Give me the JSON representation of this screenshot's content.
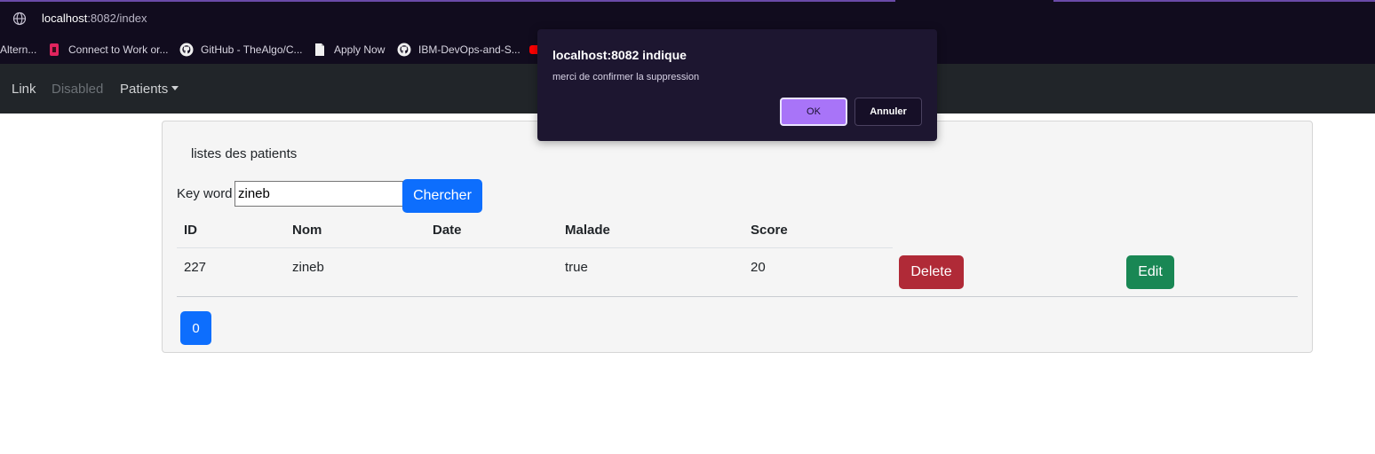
{
  "browser": {
    "url_host": "localhost",
    "url_path": ":8082/index",
    "bookmarks": [
      {
        "label": "Altern...",
        "icon": "page-icon"
      },
      {
        "label": "Connect to Work or...",
        "icon": "app-icon"
      },
      {
        "label": "GitHub - TheAlgo/C...",
        "icon": "github-icon"
      },
      {
        "label": "Apply Now",
        "icon": "document-icon"
      },
      {
        "label": "IBM-DevOps-and-S...",
        "icon": "github-icon"
      }
    ]
  },
  "navbar": {
    "link": "Link",
    "disabled": "Disabled",
    "patients": "Patients"
  },
  "card": {
    "title": "listes des patients",
    "search_label": "Key word",
    "search_value": "zineb",
    "search_button": "Chercher",
    "columns": [
      "ID",
      "Nom",
      "Date",
      "Malade",
      "Score"
    ],
    "rows": [
      {
        "id": "227",
        "nom": "zineb",
        "date": "",
        "malade": "true",
        "score": "20"
      }
    ],
    "delete_button": "Delete",
    "edit_button": "Edit",
    "page_button": "0"
  },
  "dialog": {
    "title": "localhost:8082 indique",
    "message": "merci de confirmer la suppression",
    "ok": "OK",
    "cancel": "Annuler"
  },
  "colors": {
    "primary": "#0d6efd",
    "danger": "#b02a37",
    "success": "#198754",
    "dialog_accent": "#a874f8"
  }
}
